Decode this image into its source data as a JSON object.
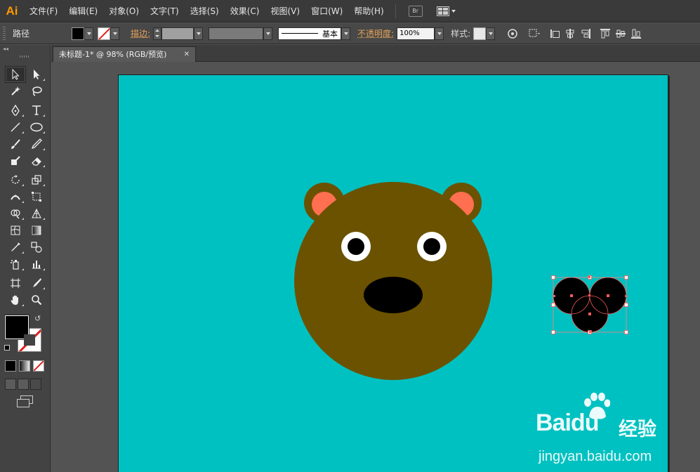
{
  "app": {
    "logo": "Ai",
    "menus": [
      "文件(F)",
      "编辑(E)",
      "对象(O)",
      "文字(T)",
      "选择(S)",
      "效果(C)",
      "视图(V)",
      "窗口(W)",
      "帮助(H)"
    ],
    "bridge_label": "Br"
  },
  "control": {
    "selection_label": "路径",
    "stroke_label": "描边:",
    "profile_label": "基本",
    "opacity_label": "不透明度:",
    "opacity_value": "100%",
    "style_label": "样式:"
  },
  "toolbox": {
    "collapse_label": "◂◂",
    "swap_glyph": "↺"
  },
  "document": {
    "tab_title": "未标题-1* @ 98% (RGB/预览)",
    "tab_close": "✕"
  },
  "colors": {
    "artboard": "#00c1c1",
    "head": "#6b5200",
    "inner_ear": "#ff6f50",
    "eye_white": "#ffffff",
    "pupil": "#000000",
    "nose": "#000000",
    "selection": "#ff5a5a"
  },
  "watermark": {
    "brand_a": "Bai",
    "brand_b": "du",
    "brand_cn": "经验",
    "url": "jingyan.baidu.com"
  }
}
